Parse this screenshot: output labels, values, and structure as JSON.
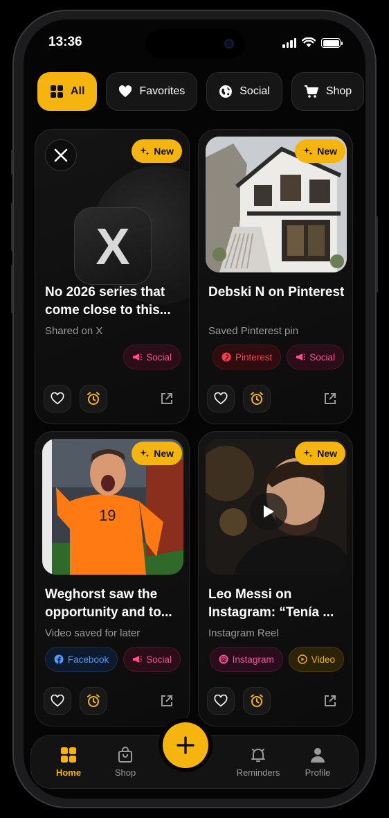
{
  "status_bar": {
    "time": "13:36"
  },
  "filters": [
    {
      "label": "All",
      "icon": "grid-icon",
      "active": true
    },
    {
      "label": "Favorites",
      "icon": "heart-icon",
      "active": false
    },
    {
      "label": "Social",
      "icon": "globe-icon",
      "active": false
    },
    {
      "label": "Shop",
      "icon": "cart-icon",
      "active": false
    }
  ],
  "cards": [
    {
      "badge": "New",
      "title": "No 2026 series that come close to this...",
      "subtitle": "Shared on X",
      "source_logo": "X",
      "tags": [
        {
          "label": "Social",
          "icon": "megaphone-icon"
        }
      ]
    },
    {
      "badge": "New",
      "title": "Debski N on Pinterest",
      "subtitle": "Saved Pinterest pin",
      "tags": [
        {
          "label": "Pinterest",
          "icon": "pinterest-icon"
        },
        {
          "label": "Social",
          "icon": "megaphone-icon"
        }
      ]
    },
    {
      "badge": "New",
      "title": "Weghorst saw the opportunity and to...",
      "subtitle": "Video saved for later",
      "jersey_number": "19",
      "tags": [
        {
          "label": "Facebook",
          "icon": "facebook-icon"
        },
        {
          "label": "Social",
          "icon": "megaphone-icon"
        }
      ]
    },
    {
      "badge": "New",
      "title": "Leo Messi on Instagram: “Tenía ...",
      "subtitle": "Instagram Reel",
      "tags": [
        {
          "label": "Instagram",
          "icon": "instagram-icon"
        },
        {
          "label": "Video",
          "icon": "play-circle-icon"
        }
      ]
    }
  ],
  "nav": {
    "home": "Home",
    "shop": "Shop",
    "reminders": "Reminders",
    "profile": "Profile"
  },
  "colors": {
    "accent": "#f6b40e",
    "background": "#050505",
    "card": "#121212"
  }
}
